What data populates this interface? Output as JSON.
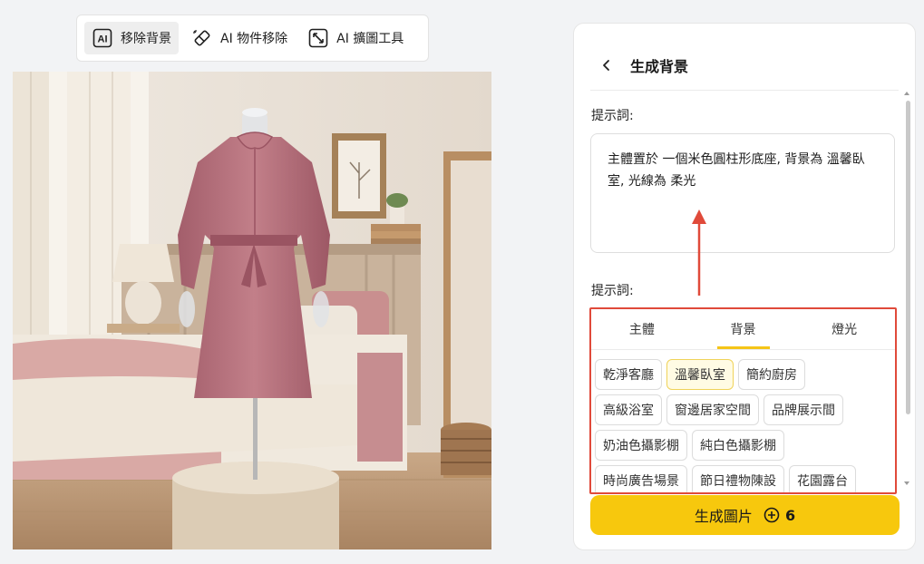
{
  "toolbar": {
    "tools": [
      {
        "label": "移除背景",
        "icon": "ai-remove-bg-icon",
        "active": true
      },
      {
        "label": "AI 物件移除",
        "icon": "eraser-icon",
        "active": false
      },
      {
        "label": "AI 擴圖工具",
        "icon": "expand-icon",
        "active": false
      }
    ]
  },
  "canvas": {
    "subject": "pink dress on mannequin in bedroom"
  },
  "panel": {
    "title": "生成背景",
    "prompt_label": "提示詞:",
    "prompt_text": "主體置於 一個米色圓柱形底座, 背景為 溫馨臥室, 光線為 柔光",
    "preset_label": "提示詞:",
    "tabs": [
      "主體",
      "背景",
      "燈光"
    ],
    "active_tab": "背景",
    "chips": [
      [
        "乾淨客廳",
        "溫馨臥室",
        "簡約廚房"
      ],
      [
        "高級浴室",
        "窗邊居家空間",
        "品牌展示間"
      ],
      [
        "奶油色攝影棚",
        "純白色攝影棚"
      ],
      [
        "時尚廣告場景",
        "節日禮物陳設",
        "花園露台"
      ]
    ],
    "selected_chip": "溫馨臥室",
    "generate_label": "生成圖片",
    "generate_cost": "6"
  },
  "colors": {
    "accent_yellow": "#f7c80d",
    "highlight_red": "#e04a3a",
    "dress_pink": "#b96f7a"
  }
}
